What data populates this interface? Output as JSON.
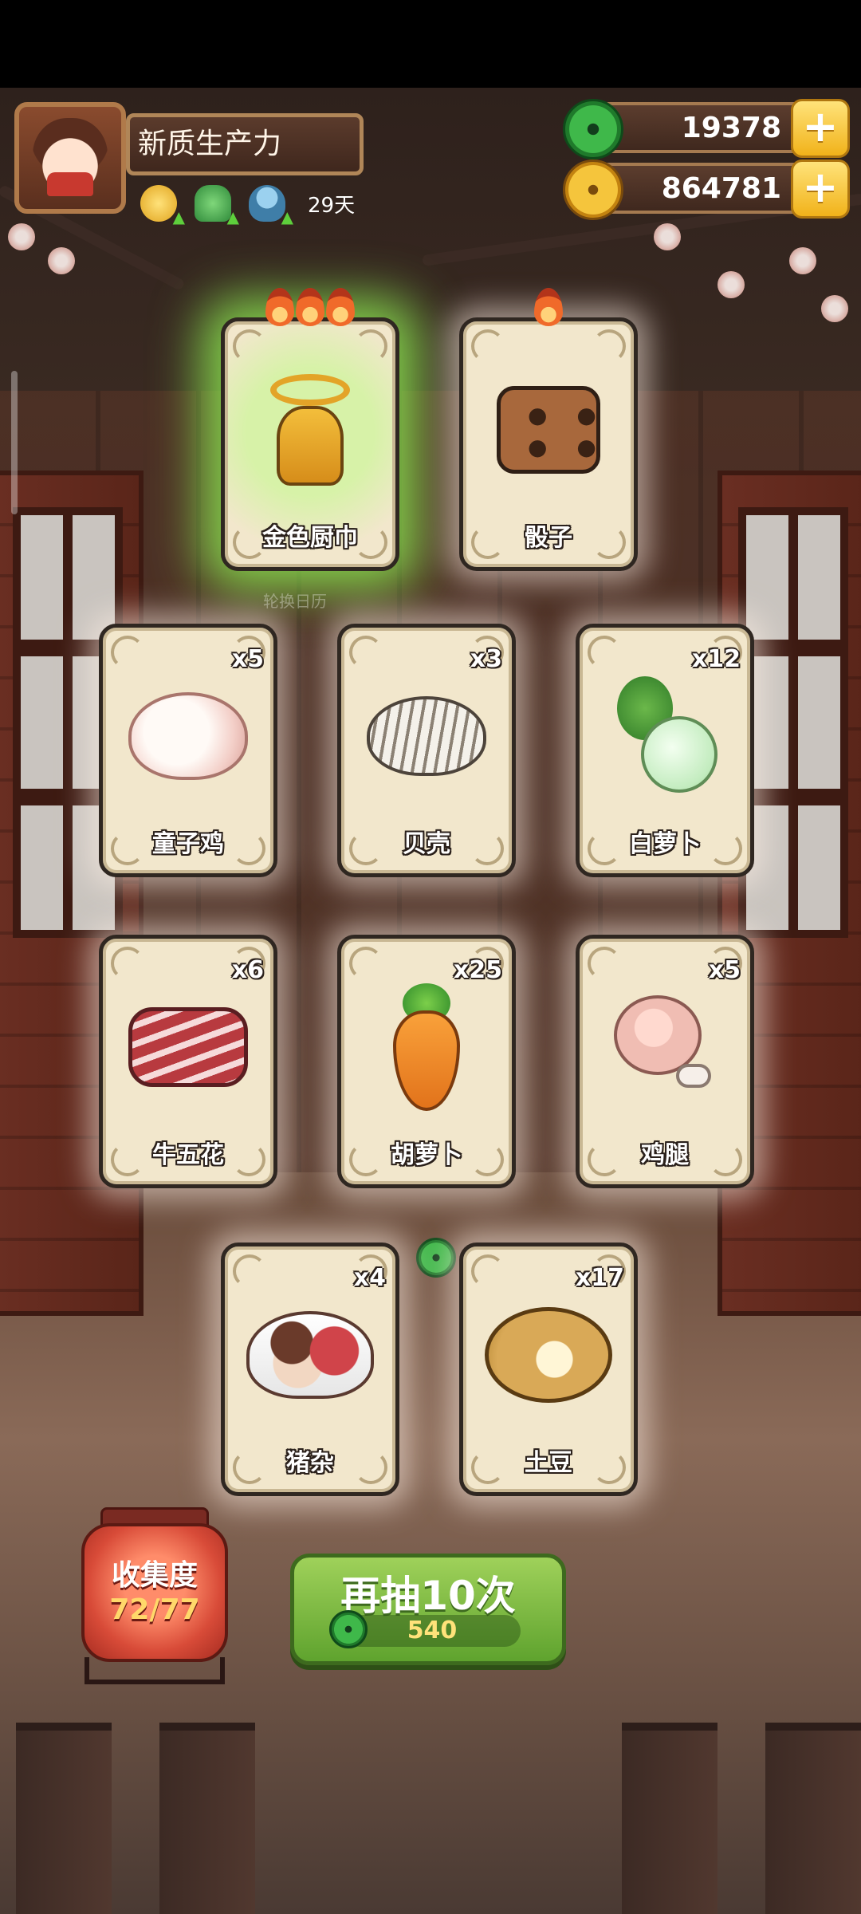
{
  "player": {
    "name": "新质生产力",
    "days": "29天"
  },
  "currencies": {
    "jade": "19378",
    "gold": "864781"
  },
  "featured_cards": [
    {
      "name": "金色厨巾",
      "icon": "golden-towel-icon",
      "flames": 3,
      "highlight": true
    },
    {
      "name": "骰子",
      "icon": "dice-icon",
      "flames": 1,
      "highlight": false
    }
  ],
  "subtext": "轮换日历",
  "cards": [
    {
      "name": "童子鸡",
      "count": "x5",
      "icon": "chicken-icon"
    },
    {
      "name": "贝壳",
      "count": "x3",
      "icon": "clam-icon"
    },
    {
      "name": "白萝卜",
      "count": "x12",
      "icon": "radish-icon"
    },
    {
      "name": "牛五花",
      "count": "x6",
      "icon": "beef-icon"
    },
    {
      "name": "胡萝卜",
      "count": "x25",
      "icon": "carrot-icon"
    },
    {
      "name": "鸡腿",
      "count": "x5",
      "icon": "drumstick-icon"
    },
    {
      "name": "猪杂",
      "count": "x4",
      "icon": "pork-offal-icon"
    },
    {
      "name": "土豆",
      "count": "x17",
      "icon": "potato-icon"
    }
  ],
  "collection": {
    "label": "收集度",
    "value": "72/77"
  },
  "draw_button": {
    "label": "再抽10次",
    "cost": "540"
  },
  "colors": {
    "glow_green": "#8ce650",
    "button_green": "#5fa32e",
    "lantern_red": "#d84b38"
  }
}
